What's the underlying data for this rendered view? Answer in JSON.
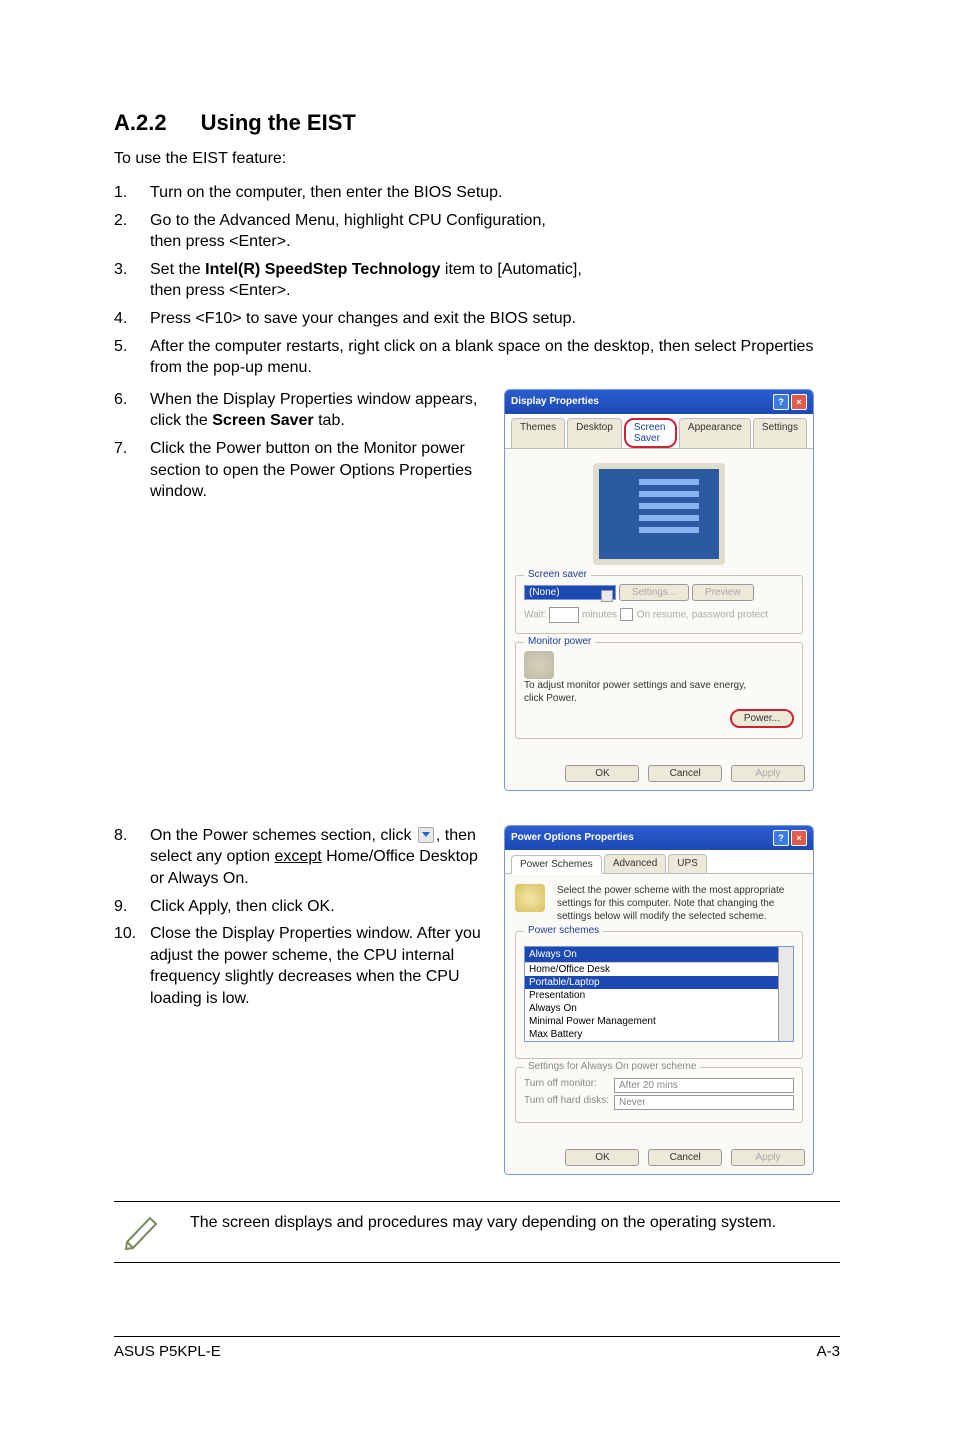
{
  "heading": {
    "number": "A.2.2",
    "title": "Using the EIST"
  },
  "intro": "To use the EIST feature:",
  "steps_a": [
    {
      "n": "1.",
      "t": "Turn on the computer, then enter the BIOS Setup."
    },
    {
      "n": "2.",
      "t_pre": "Go to the Advanced Menu, highlight CPU Configuration,",
      "t_post": "then press <Enter>."
    },
    {
      "n": "3.",
      "t_pre": "Set the ",
      "bold": "Intel(R) SpeedStep Technology",
      "t_mid": " item to [Automatic],",
      "t_post": "then press <Enter>."
    },
    {
      "n": "4.",
      "t": "Press <F10> to save your changes and exit the BIOS setup."
    },
    {
      "n": "5.",
      "t": "After the computer restarts, right click on a blank space on the desktop, then select Properties from the pop-up menu."
    }
  ],
  "steps_b": [
    {
      "n": "6.",
      "t_pre": "When the Display Properties window appears, click the ",
      "bold": "Screen Saver",
      "t_post": " tab."
    },
    {
      "n": "7.",
      "t": "Click the Power button on the Monitor power section to open the Power Options Properties window."
    }
  ],
  "steps_c": [
    {
      "n": "8.",
      "t_pre": "On the Power schemes section, click ",
      "t_mid": ", then select any option ",
      "u": "except",
      "t_post": " Home/Office Desktop or Always On."
    },
    {
      "n": "9.",
      "t": "Click Apply, then click OK."
    },
    {
      "n": "10.",
      "t": "Close the Display Properties window. After you adjust the power scheme, the CPU internal frequency slightly decreases when the CPU loading is low."
    }
  ],
  "note": "The screen displays and procedures may vary depending on the operating system.",
  "dlg1": {
    "title": "Display Properties",
    "tabs": {
      "themes": "Themes",
      "desktop": "Desktop",
      "screensaver": "Screen Saver",
      "appearance": "Appearance",
      "settings": "Settings"
    },
    "group_ss": "Screen saver",
    "ss_value": "(None)",
    "btn_settings": "Settings...",
    "btn_preview": "Preview",
    "wait": "Wait:",
    "minutes": "minutes",
    "resume_chk": "On resume, password protect",
    "group_mon": "Monitor power",
    "mon_text": "To adjust monitor power settings and save energy, click Power.",
    "btn_power": "Power...",
    "ok": "OK",
    "cancel": "Cancel",
    "apply": "Apply"
  },
  "dlg2": {
    "title": "Power Options Properties",
    "tabs": {
      "schemes": "Power Schemes",
      "advanced": "Advanced",
      "ups": "UPS"
    },
    "desc": "Select the power scheme with the most appropriate settings for this computer. Note that changing the settings below will modify the selected scheme.",
    "group_ps": "Power schemes",
    "combo_current": "Always On",
    "opts": [
      "Home/Office Desk",
      "Portable/Laptop",
      "Presentation",
      "Always On",
      "Minimal Power Management",
      "Max Battery"
    ],
    "settings_group": "Settings for Always On power scheme",
    "row_mon": "Turn off monitor:",
    "row_mon_val": "After 20 mins",
    "row_hd": "Turn off hard disks:",
    "row_hd_val": "Never",
    "ok": "OK",
    "cancel": "Cancel",
    "apply": "Apply"
  },
  "footer": {
    "left": "ASUS P5KPL-E",
    "right": "A-3"
  }
}
